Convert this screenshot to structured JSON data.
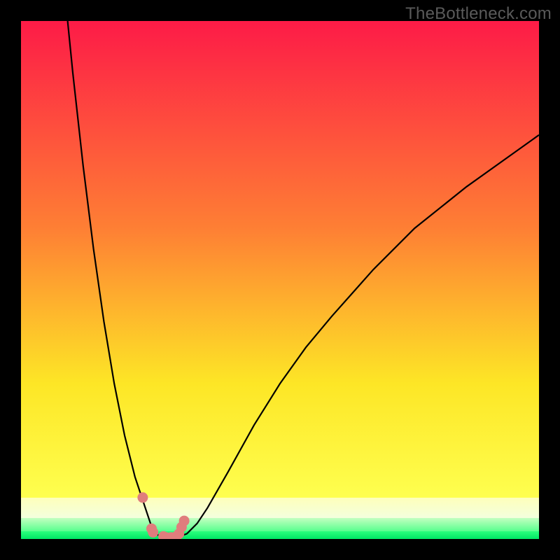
{
  "watermark": "TheBottleneck.com",
  "chart_data": {
    "type": "line",
    "title": "",
    "xlabel": "",
    "ylabel": "",
    "xlim": [
      0,
      100
    ],
    "ylim": [
      0,
      100
    ],
    "grid": false,
    "legend": false,
    "series": [
      {
        "name": "bottleneck-curve",
        "x": [
          9,
          10,
          12,
          14,
          16,
          18,
          20,
          22,
          23,
          24,
          25,
          26,
          27,
          28,
          30,
          32,
          34,
          36,
          40,
          45,
          50,
          55,
          60,
          68,
          76,
          86,
          100
        ],
        "values": [
          100,
          90,
          72,
          56,
          42,
          30,
          20,
          12,
          9,
          6,
          3,
          1,
          0.5,
          0.3,
          0.3,
          1,
          3,
          6,
          13,
          22,
          30,
          37,
          43,
          52,
          60,
          68,
          78
        ]
      }
    ],
    "points": {
      "name": "highlight-points",
      "x": [
        23.5,
        25.2,
        25.5,
        27.5,
        28.0,
        29.0,
        30.0,
        30.5,
        31.0,
        31.5
      ],
      "values": [
        8.0,
        2.0,
        1.3,
        0.5,
        0.3,
        0.3,
        0.5,
        1.0,
        2.3,
        3.5
      ]
    },
    "gradient_bands": [
      {
        "name": "red",
        "from": 100,
        "to": 60,
        "color_top": "#fd1b47",
        "color_bottom": "#fe7f34"
      },
      {
        "name": "orange",
        "from": 60,
        "to": 30,
        "color_top": "#fe7f34",
        "color_bottom": "#fde626"
      },
      {
        "name": "yellow",
        "from": 30,
        "to": 8,
        "color_top": "#fde626",
        "color_bottom": "#feff4f"
      },
      {
        "name": "pale",
        "from": 8,
        "to": 4,
        "color_top": "#feffbb",
        "color_bottom": "#f3ffdd"
      },
      {
        "name": "lightgreen",
        "from": 4,
        "to": 1.5,
        "color_top": "#c3ffc0",
        "color_bottom": "#58ff8e"
      },
      {
        "name": "green",
        "from": 1.5,
        "to": 0,
        "color_top": "#2bff7c",
        "color_bottom": "#00e765"
      }
    ]
  }
}
